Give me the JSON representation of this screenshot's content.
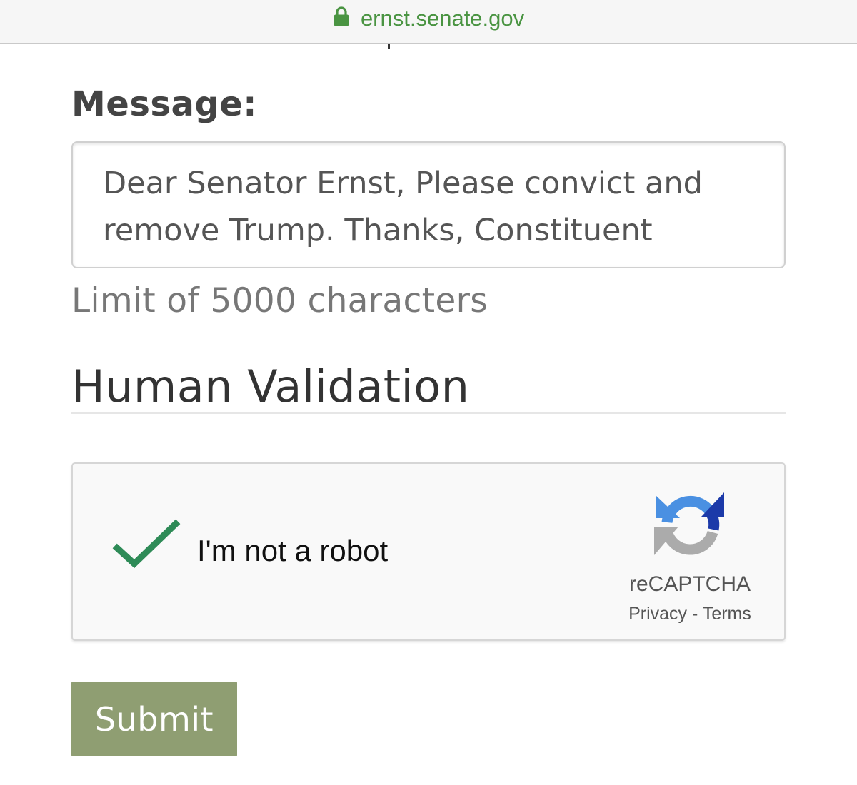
{
  "browser": {
    "url": "ernst.senate.gov",
    "lock_icon": "lock-icon",
    "accent_color": "#4a9442"
  },
  "form": {
    "message_label": "Message:",
    "message_value": "Dear Senator Ernst, Please convict and remove Trump. Thanks, Constituent",
    "limit_text": "Limit of 5000 characters",
    "section_title": "Human Validation",
    "submit_label": "Submit",
    "submit_color": "#8f9e72"
  },
  "captcha": {
    "checked": true,
    "checkbox_label": "I'm not a robot",
    "brand": "reCAPTCHA",
    "privacy_label": "Privacy",
    "separator": " - ",
    "terms_label": "Terms",
    "check_icon": "checkmark-icon",
    "logo_icon": "recaptcha-logo-icon",
    "check_color": "#2e8b57"
  }
}
